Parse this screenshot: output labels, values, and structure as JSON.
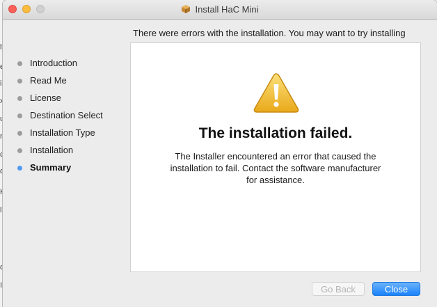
{
  "window": {
    "title": "Install HaC Mini",
    "title_icon": "package-icon"
  },
  "background_fragments": [
    "ly",
    "e",
    "ic",
    "xt",
    "u",
    "ne",
    "c",
    "ca",
    "K",
    "li",
    "ch",
    "IE"
  ],
  "header": {
    "message": "There were errors with the installation. You may want to try installing"
  },
  "sidebar": {
    "items": [
      {
        "label": "Introduction",
        "active": false
      },
      {
        "label": "Read Me",
        "active": false
      },
      {
        "label": "License",
        "active": false
      },
      {
        "label": "Destination Select",
        "active": false
      },
      {
        "label": "Installation Type",
        "active": false
      },
      {
        "label": "Installation",
        "active": false
      },
      {
        "label": "Summary",
        "active": true
      }
    ]
  },
  "main": {
    "icon": "warning-icon",
    "heading": "The installation failed.",
    "body_lines": [
      "The Installer encountered an error that caused the",
      "installation to fail. Contact the software manufacturer",
      "for assistance."
    ]
  },
  "buttons": {
    "back_label": "Go Back",
    "back_enabled": false,
    "close_label": "Close"
  },
  "colors": {
    "accent": "#1a82fb",
    "active_dot": "#4f9bf2",
    "inactive_dot": "#9c9c9c",
    "warning_fill": "#f3c32c"
  }
}
